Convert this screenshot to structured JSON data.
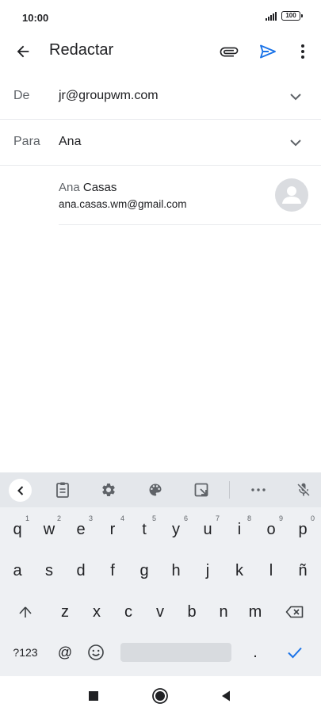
{
  "status_bar": {
    "time": "10:00",
    "battery": "100"
  },
  "app_bar": {
    "title": "Redactar"
  },
  "fields": {
    "from": {
      "label": "De",
      "value": "jr@groupwm.com"
    },
    "to": {
      "label": "Para",
      "value": "Ana"
    }
  },
  "suggestion": {
    "name_match": "Ana",
    "name_rest": " Casas",
    "email": "ana.casas.wm@gmail.com"
  },
  "keyboard": {
    "row1": [
      {
        "key": "q",
        "hint": "1"
      },
      {
        "key": "w",
        "hint": "2"
      },
      {
        "key": "e",
        "hint": "3"
      },
      {
        "key": "r",
        "hint": "4"
      },
      {
        "key": "t",
        "hint": "5"
      },
      {
        "key": "y",
        "hint": "6"
      },
      {
        "key": "u",
        "hint": "7"
      },
      {
        "key": "i",
        "hint": "8"
      },
      {
        "key": "o",
        "hint": "9"
      },
      {
        "key": "p",
        "hint": "0"
      }
    ],
    "row2": [
      "a",
      "s",
      "d",
      "f",
      "g",
      "h",
      "j",
      "k",
      "l",
      "ñ"
    ],
    "row3": [
      "z",
      "x",
      "c",
      "v",
      "b",
      "n",
      "m"
    ],
    "symbols_label": "?123",
    "at_label": "@",
    "period_label": "."
  },
  "colors": {
    "accent": "#1a73e8",
    "icon": "#5f6368"
  }
}
